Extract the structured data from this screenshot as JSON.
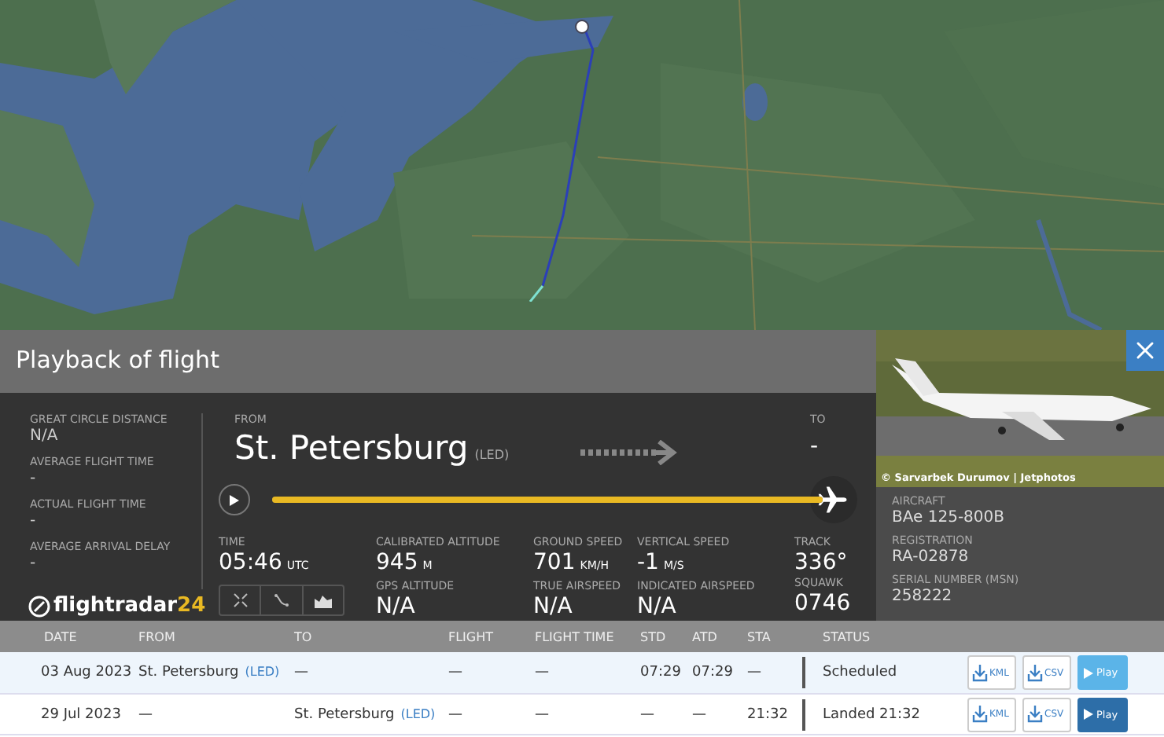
{
  "panel": {
    "title": "Playback of flight"
  },
  "stats": [
    {
      "label": "GREAT CIRCLE DISTANCE",
      "value": "N/A"
    },
    {
      "label": "AVERAGE FLIGHT TIME",
      "value": "-"
    },
    {
      "label": "ACTUAL FLIGHT TIME",
      "value": "-"
    },
    {
      "label": "AVERAGE ARRIVAL DELAY",
      "value": "-"
    }
  ],
  "logo": {
    "name": "flightradar",
    "suffix": "24"
  },
  "route": {
    "from_label": "FROM",
    "from_city": "St. Petersburg",
    "from_code": "(LED)",
    "to_label": "TO",
    "to_value": "-"
  },
  "progress": {
    "level": 1
  },
  "readouts": [
    {
      "label": "TIME",
      "value": "05:46",
      "unit": "UTC"
    },
    {
      "label": "CALIBRATED ALTITUDE",
      "value": "945",
      "unit": "M",
      "label2": "GPS ALTITUDE",
      "value2": "N/A"
    },
    {
      "label": "GROUND SPEED",
      "value": "701",
      "unit": "KM/H",
      "label2": "TRUE AIRSPEED",
      "value2": "N/A"
    },
    {
      "label": "VERTICAL SPEED",
      "value": "-1",
      "unit": "M/S",
      "label2": "INDICATED AIRSPEED",
      "value2": "N/A"
    },
    {
      "label": "TRACK",
      "value": "336°",
      "label2": "SQUAWK",
      "value2": "0746"
    }
  ],
  "photo": {
    "caption": "© Sarvarbek Durumov | Jetphotos"
  },
  "aircraft": [
    {
      "label": "AIRCRAFT",
      "value": "BAe 125-800B"
    },
    {
      "label": "REGISTRATION",
      "value": "RA-02878"
    },
    {
      "label": "SERIAL NUMBER (MSN)",
      "value": "258222"
    }
  ],
  "table": {
    "columns": [
      "DATE",
      "FROM",
      "TO",
      "FLIGHT",
      "FLIGHT TIME",
      "STD",
      "ATD",
      "STA",
      "STATUS"
    ],
    "rows": [
      {
        "selected": true,
        "date": "03 Aug 2023",
        "from": "St. Petersburg",
        "from_code": "(LED)",
        "to": "—",
        "to_code": "",
        "flight": "—",
        "flight_time": "—",
        "std": "07:29",
        "atd": "07:29",
        "sta": "—",
        "status": "Scheduled",
        "kml": "KML",
        "csv": "CSV",
        "play": "Play"
      },
      {
        "selected": false,
        "date": "29 Jul 2023",
        "from": "—",
        "from_code": "",
        "to": "St. Petersburg",
        "to_code": "(LED)",
        "flight": "—",
        "flight_time": "—",
        "std": "—",
        "atd": "—",
        "sta": "21:32",
        "status": "Landed 21:32",
        "kml": "KML",
        "csv": "CSV",
        "play": "Play"
      }
    ]
  }
}
